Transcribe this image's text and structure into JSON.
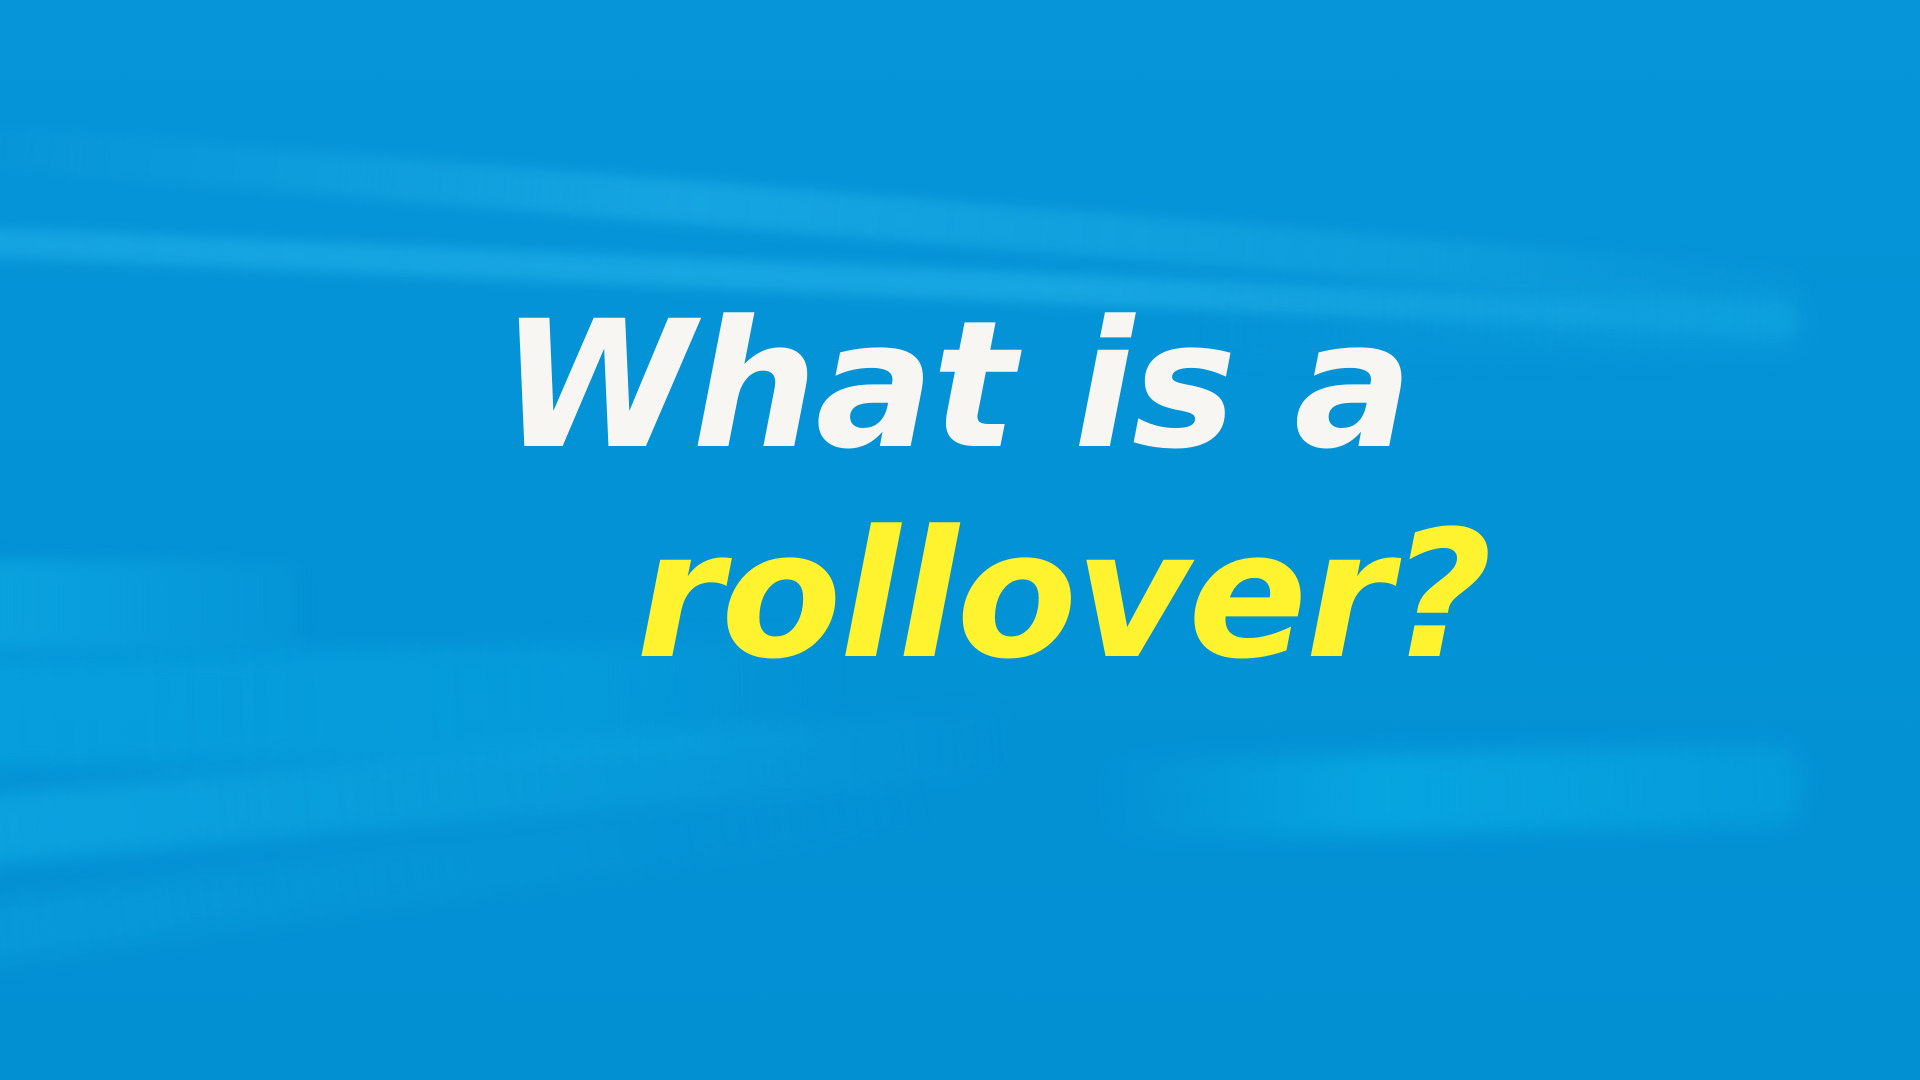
{
  "headline": {
    "line1": "What is a",
    "line2": "rollover?"
  },
  "colors": {
    "background": "#0293d6",
    "line1_text": "#f8f6f3",
    "line2_text": "#fff22e"
  }
}
